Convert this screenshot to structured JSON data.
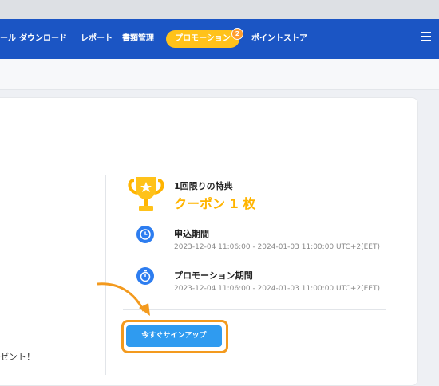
{
  "nav": {
    "items": [
      "ール",
      "ダウンロード",
      "レポート",
      "書類管理"
    ],
    "promotion_label": "プロモーション",
    "promotion_badge": "2",
    "points_store": "ポイントストア"
  },
  "benefit": {
    "title": "1回限りの特典",
    "value": "クーポン 1 枚"
  },
  "application_period": {
    "label": "申込期間",
    "range": "2023-12-04 11:06:00 - 2024-01-03 11:00:00 UTC+2(EET)"
  },
  "promotion_period": {
    "label": "プロモーション期間",
    "range": "2023-12-04 11:06:00 - 2024-01-03 11:00:00 UTC+2(EET)"
  },
  "signup_button": "今すぐサインアップ",
  "left_text": "ゼント！",
  "colors": {
    "nav_bg": "#1b55c4",
    "promo": "#ffc21a",
    "accent_gold": "#ffb400",
    "button": "#2f9bf0",
    "highlight": "#f39a1e"
  }
}
